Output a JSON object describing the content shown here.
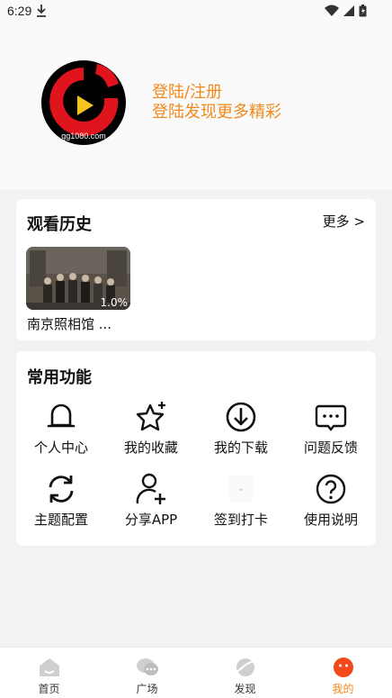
{
  "status_bar": {
    "time": "6:29"
  },
  "profile": {
    "avatar_site": "gg1080.com",
    "login_title": "登陆/注册",
    "login_subtitle": "登陆发现更多精彩"
  },
  "history": {
    "title": "观看历史",
    "more_label": "更多 >",
    "items": [
      {
        "name": "南京照相馆 ...",
        "progress": "1.0%"
      }
    ]
  },
  "features": {
    "title": "常用功能",
    "items": [
      {
        "label": "个人中心",
        "icon": "bell-icon"
      },
      {
        "label": "我的收藏",
        "icon": "star-icon"
      },
      {
        "label": "我的下载",
        "icon": "download-icon"
      },
      {
        "label": "问题反馈",
        "icon": "feedback-icon"
      },
      {
        "label": "主题配置",
        "icon": "refresh-icon"
      },
      {
        "label": "分享APP",
        "icon": "add-user-icon"
      },
      {
        "label": "签到打卡",
        "icon": "checkin-icon"
      },
      {
        "label": "使用说明",
        "icon": "help-icon"
      }
    ]
  },
  "tabbar": {
    "active": "我的",
    "tabs": [
      {
        "label": "首页",
        "icon": "home-icon"
      },
      {
        "label": "广场",
        "icon": "chat-icon"
      },
      {
        "label": "发现",
        "icon": "planet-icon"
      },
      {
        "label": "我的",
        "icon": "face-icon"
      }
    ]
  },
  "colors": {
    "accent": "#f08a1c",
    "background": "#f2f2f2",
    "card": "#ffffff"
  }
}
